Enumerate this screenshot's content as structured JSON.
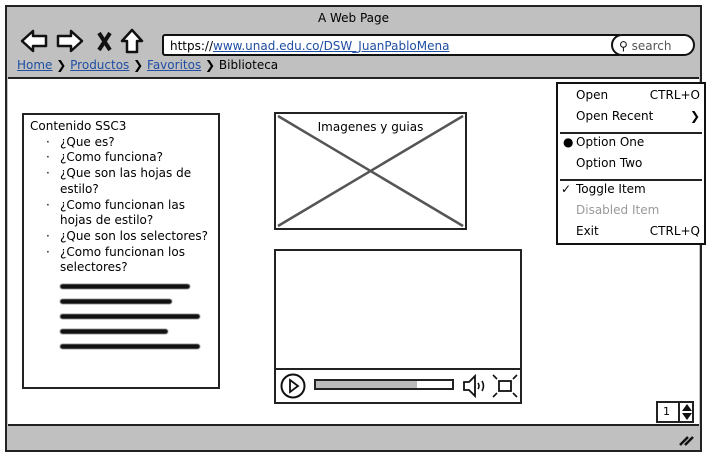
{
  "window": {
    "title": "A Web Page"
  },
  "toolbar": {
    "url_prefix": "https://",
    "url_link": "www.unad.edu.co/DSW_JuanPabloMena",
    "search_placeholder": "search"
  },
  "breadcrumb": [
    {
      "label": "Home",
      "link": true
    },
    {
      "label": "Productos",
      "link": true
    },
    {
      "label": "Favoritos",
      "link": true
    },
    {
      "label": "Biblioteca",
      "link": false
    }
  ],
  "panel": {
    "title": "Contenido SSC3",
    "items": [
      "¿Que es?",
      "¿Como funciona?",
      "¿Que son las hojas de estilo?",
      "¿Como funcionan las hojas de estilo?",
      "¿Que son los selectores?",
      "¿Como funcionan los selectores?"
    ]
  },
  "image": {
    "caption": "Imagenes y guias"
  },
  "video": {
    "progress_percent": 74
  },
  "menu": {
    "items": [
      {
        "label": "Open",
        "shortcut": "CTRL+O"
      },
      {
        "label": "Open Recent",
        "submenu": true
      },
      {
        "label": "Option One",
        "selected": true
      },
      {
        "label": "Option Two"
      },
      {
        "label": "Toggle Item",
        "checked": true
      },
      {
        "label": "Disabled Item",
        "disabled": true
      },
      {
        "label": "Exit",
        "shortcut": "CTRL+Q"
      }
    ]
  },
  "stepper": {
    "value": "1"
  },
  "colors": {
    "chrome": "#c0c0c0",
    "link": "#1f4ea3",
    "disabled": "#999999"
  }
}
